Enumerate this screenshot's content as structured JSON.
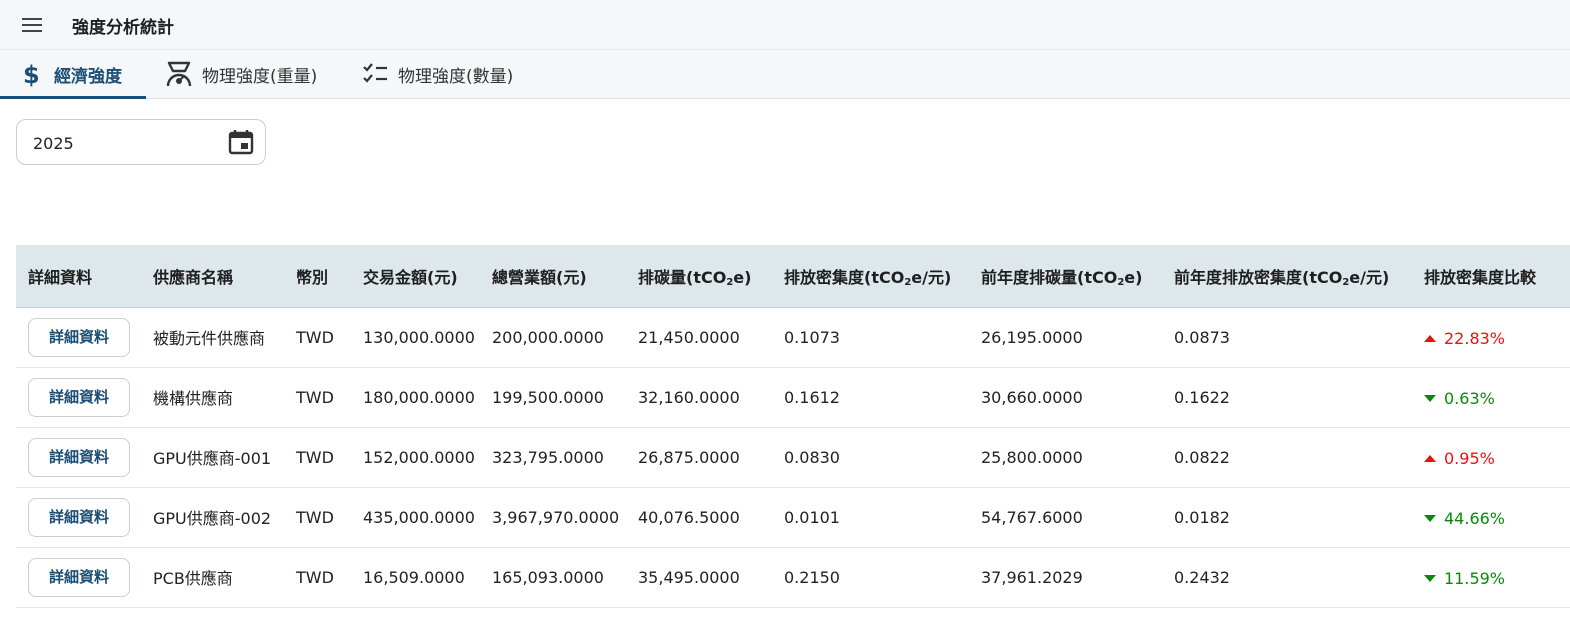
{
  "header": {
    "title": "強度分析統計",
    "menu_icon": "hamburger-menu-icon"
  },
  "tabs": [
    {
      "label": "經濟強度",
      "icon": "dollar-icon",
      "active": true
    },
    {
      "label": "物理強度(重量)",
      "icon": "scale-icon",
      "active": false
    },
    {
      "label": "物理強度(數量)",
      "icon": "checklist-icon",
      "active": false
    }
  ],
  "filter": {
    "year": "2025",
    "calendar_icon": "calendar-icon"
  },
  "table": {
    "headers": {
      "detail": "詳細資料",
      "supplier": "供應商名稱",
      "currency": "幣別",
      "amount": "交易金額(元)",
      "revenue": "總營業額(元)",
      "emission_a": "排碳量(tCO",
      "emission_b": "e)",
      "intensity_a": "排放密集度(tCO",
      "intensity_b": "e/元)",
      "prev_emission_a": "前年度排碳量(tCO",
      "prev_emission_b": "e)",
      "prev_intensity_a": "前年度排放密集度(tCO",
      "prev_intensity_b": "e/元)",
      "compare": "排放密集度比較",
      "sub2": "2"
    },
    "rows": [
      {
        "detail": "詳細資料",
        "supplier": "被動元件供應商",
        "currency": "TWD",
        "amount": "130,000.0000",
        "revenue": "200,000.0000",
        "emission": "21,450.0000",
        "intensity": "0.1073",
        "prev_emission": "26,195.0000",
        "prev_intensity": "0.0873",
        "compare": "22.83%",
        "direction": "up"
      },
      {
        "detail": "詳細資料",
        "supplier": "機構供應商",
        "currency": "TWD",
        "amount": "180,000.0000",
        "revenue": "199,500.0000",
        "emission": "32,160.0000",
        "intensity": "0.1612",
        "prev_emission": "30,660.0000",
        "prev_intensity": "0.1622",
        "compare": "0.63%",
        "direction": "down"
      },
      {
        "detail": "詳細資料",
        "supplier": "GPU供應商-001",
        "currency": "TWD",
        "amount": "152,000.0000",
        "revenue": "323,795.0000",
        "emission": "26,875.0000",
        "intensity": "0.0830",
        "prev_emission": "25,800.0000",
        "prev_intensity": "0.0822",
        "compare": "0.95%",
        "direction": "up"
      },
      {
        "detail": "詳細資料",
        "supplier": "GPU供應商-002",
        "currency": "TWD",
        "amount": "435,000.0000",
        "revenue": "3,967,970.0000",
        "emission": "40,076.5000",
        "intensity": "0.0101",
        "prev_emission": "54,767.6000",
        "prev_intensity": "0.0182",
        "compare": "44.66%",
        "direction": "down"
      },
      {
        "detail": "詳細資料",
        "supplier": "PCB供應商",
        "currency": "TWD",
        "amount": "16,509.0000",
        "revenue": "165,093.0000",
        "emission": "35,495.0000",
        "intensity": "0.2150",
        "prev_emission": "37,961.2029",
        "prev_intensity": "0.2432",
        "compare": "11.59%",
        "direction": "down"
      }
    ]
  },
  "colors": {
    "accent": "#1c4f75",
    "up": "#ee1111",
    "down": "#0a8a0a",
    "header_bg": "#dde7ec"
  }
}
